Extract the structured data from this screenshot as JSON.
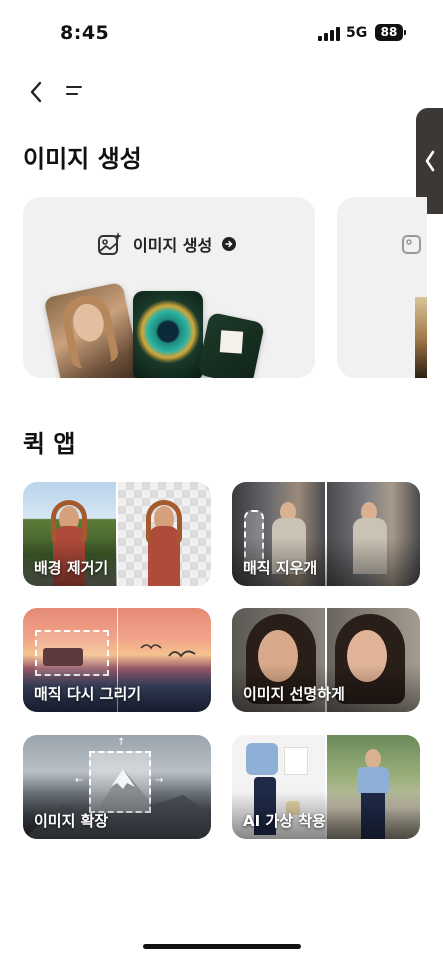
{
  "status_bar": {
    "time": "8:45",
    "network": "5G",
    "battery": "88"
  },
  "sections": {
    "generate_title": "이미지 생성",
    "quick_apps_title": "퀵 앱"
  },
  "generate_card": {
    "label": "이미지 생성",
    "icon": "image-sparkle-icon"
  },
  "quick_apps": [
    {
      "label": "배경 제거기"
    },
    {
      "label": "매직 지우개"
    },
    {
      "label": "매직 다시 그리기"
    },
    {
      "label": "이미지 선명하게"
    },
    {
      "label": "이미지 확장"
    },
    {
      "label": "AI 가상 착용"
    }
  ],
  "colors": {
    "card_bg": "#f1f1f2",
    "side_tab": "#3b3836",
    "text": "#111111"
  }
}
